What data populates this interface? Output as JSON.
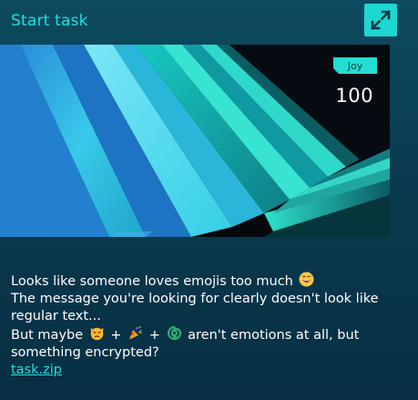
{
  "task": {
    "title": "Start task",
    "category_badge": "Joy",
    "points": "100",
    "description": {
      "line1": "Looks like someone loves emojis too much",
      "line2": "The message you're looking for clearly doesn't look like",
      "line3": "regular text...",
      "line4_start": "But maybe",
      "plus": "+",
      "line4_end": "aren't emotions at all, but",
      "line5": "something encrypted?"
    },
    "attachment": "task.zip"
  },
  "icons": {
    "expand": "expand-icon",
    "emoji_1": "grinning-sweat-emoji",
    "emoji_2": "pouting-cat-emoji",
    "emoji_3": "party-popper-emoji",
    "emoji_4": "cyclone-emoji"
  },
  "colors": {
    "accent": "#20e0da",
    "background": "#0a3a4f",
    "text": "#ffffff"
  }
}
